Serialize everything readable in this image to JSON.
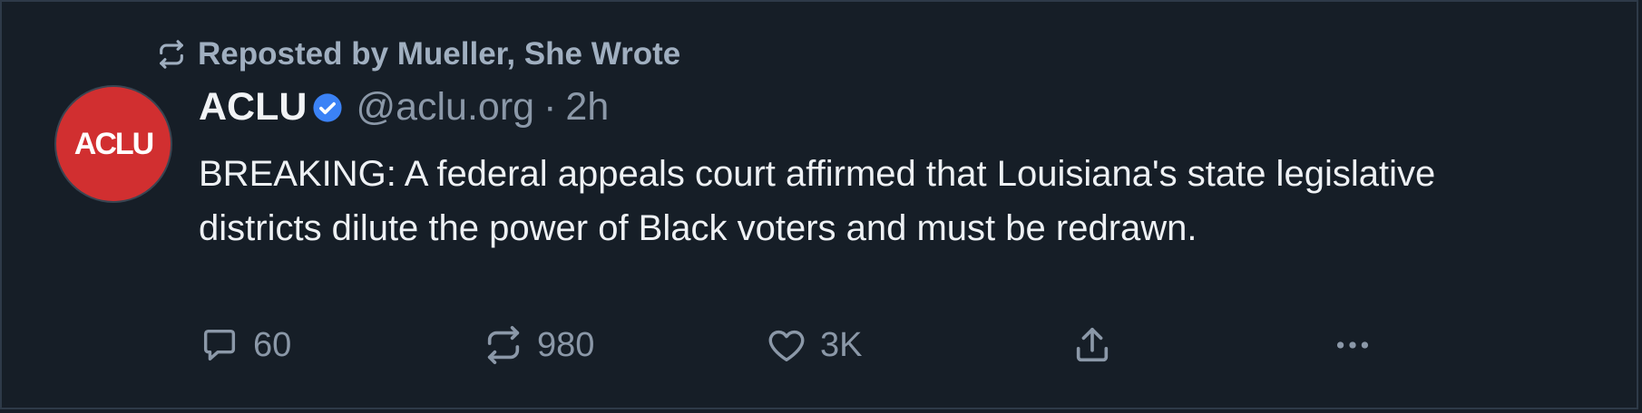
{
  "repost": {
    "label": "Reposted by Mueller, She Wrote",
    "icon": "repost-icon"
  },
  "author": {
    "avatar_text": "ACLU",
    "avatar_color": "#d12f30",
    "display_name": "ACLU",
    "verified": true,
    "verified_color": "#3b82f6",
    "handle": "@aclu.org",
    "separator": "·",
    "time": "2h"
  },
  "post": {
    "text": "BREAKING: A federal appeals court affirmed that Louisiana's state legislative districts dilute the power of Black voters and must be redrawn."
  },
  "actions": {
    "reply": {
      "icon": "reply-icon",
      "count": "60"
    },
    "repost": {
      "icon": "repost-icon",
      "count": "980"
    },
    "like": {
      "icon": "heart-icon",
      "count": "3K"
    },
    "share": {
      "icon": "share-icon"
    },
    "more": {
      "icon": "more-icon"
    }
  },
  "colors": {
    "background": "#161e27",
    "text_primary": "#eef1f4",
    "text_secondary": "#8b98a8",
    "border": "#2e3a48"
  }
}
